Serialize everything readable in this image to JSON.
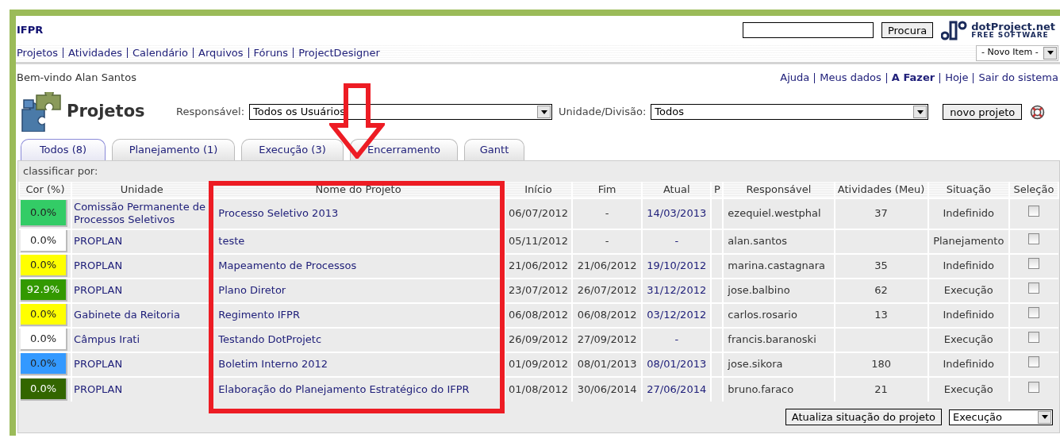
{
  "header": {
    "org": "IFPR",
    "search_button": "Procura",
    "logo": {
      "name": "dotProject.net",
      "tagline": "FREE SOFTWARE"
    }
  },
  "nav": {
    "items": [
      "Projetos",
      "Atividades",
      "Calendário",
      "Arquivos",
      "Fóruns",
      "ProjectDesigner"
    ],
    "new_item": "- Novo Item -"
  },
  "user_bar": {
    "welcome": "Bem-vindo Alan Santos",
    "links": [
      {
        "label": "Ajuda",
        "bold": false
      },
      {
        "label": "Meus dados",
        "bold": false
      },
      {
        "label": "A Fazer",
        "bold": true
      },
      {
        "label": "Hoje",
        "bold": false
      },
      {
        "label": "Sair do sistema",
        "bold": false
      }
    ]
  },
  "page": {
    "title": "Projetos",
    "filters": [
      {
        "label": "Responsável:",
        "value": "Todos os Usuários"
      },
      {
        "label": "Unidade/Divisão:",
        "value": "Todos"
      }
    ],
    "new_button": "novo projeto"
  },
  "tabs": [
    {
      "label": "Todos (8)",
      "selected": true
    },
    {
      "label": "Planejamento (1)",
      "selected": false
    },
    {
      "label": "Execução (3)",
      "selected": false
    },
    {
      "label": "Encerramento",
      "selected": false
    },
    {
      "label": "Gantt",
      "selected": false
    }
  ],
  "table": {
    "sort_label": "classificar por:",
    "columns": [
      "Cor (%)",
      "Unidade",
      "Nome do Projeto",
      "Início",
      "Fim",
      "Atual",
      "P",
      "Responsável",
      "Atividades (Meu)",
      "Situação",
      "Seleção"
    ],
    "rows": [
      {
        "color": "#33cc66",
        "percent": "0.0%",
        "unit": "Comissão Permanente de Processos Seletivos",
        "name": "Processo Seletivo 2013",
        "start": "06/07/2012",
        "end": "-",
        "current": "14/03/2013",
        "owner": "ezequiel.westphal",
        "tasks": "37",
        "status": "Indefinido",
        "checked": false
      },
      {
        "color": "#ffffff",
        "percent": "0.0%",
        "unit": "PROPLAN",
        "name": "teste",
        "start": "05/11/2012",
        "end": "-",
        "current": "-",
        "owner": "alan.santos",
        "status": "Planejamento",
        "checked": false
      },
      {
        "color": "#ffff00",
        "percent": "0.0%",
        "unit": "PROPLAN",
        "name": "Mapeamento de Processos",
        "start": "21/06/2012",
        "end": "21/06/2012",
        "current": "19/10/2012",
        "owner": "marina.castagnara",
        "tasks": "35",
        "status": "Indefinido",
        "checked": false
      },
      {
        "color": "#339900",
        "percent": "92.9%",
        "unit": "PROPLAN",
        "name": "Plano Diretor",
        "start": "23/07/2012",
        "end": "26/07/2012",
        "current": "31/12/2012",
        "owner": "jose.balbino",
        "tasks": "62",
        "status": "Execução",
        "checked": false
      },
      {
        "color": "#ffff00",
        "percent": "0.0%",
        "unit": "Gabinete da Reitoria",
        "name": "Regimento IFPR",
        "start": "06/08/2012",
        "end": "06/08/2012",
        "current": "03/12/2012",
        "owner": "carlos.rosario",
        "tasks": "13",
        "status": "Indefinido",
        "checked": false
      },
      {
        "color": "#ffffff",
        "percent": "0.0%",
        "unit": "Câmpus Irati",
        "name": "Testando DotProjetc",
        "start": "26/09/2012",
        "end": "27/09/2012",
        "current": "-",
        "owner": "francis.baranoski",
        "status": "Execução",
        "checked": false
      },
      {
        "color": "#3399ff",
        "percent": "0.0%",
        "unit": "PROPLAN",
        "name": "Boletim Interno 2012",
        "start": "01/09/2012",
        "end": "08/01/2013",
        "current": "08/01/2013",
        "owner": "jose.sikora",
        "tasks": "180",
        "status": "Indefinido",
        "checked": false
      },
      {
        "color": "#336600",
        "percent": "0.0%",
        "unit": "PROPLAN",
        "name": "Elaboração do Planejamento Estratégico do IFPR",
        "start": "01/08/2012",
        "end": "30/06/2014",
        "current": "27/06/2014",
        "owner": "bruno.faraco",
        "tasks": "21",
        "status": "Execução",
        "checked": false
      }
    ]
  },
  "footer": {
    "update_button": "Atualiza situação do projeto",
    "status_select": "Execução"
  }
}
